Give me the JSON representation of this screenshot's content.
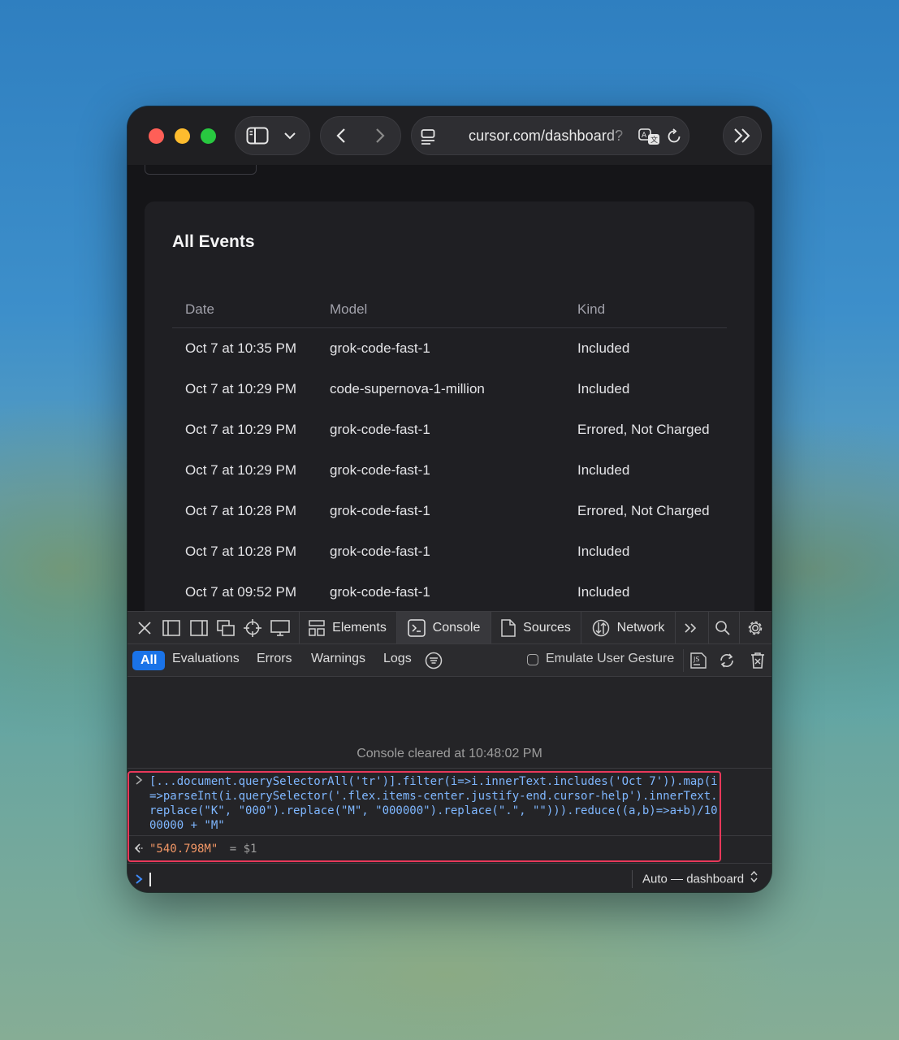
{
  "browser": {
    "url": "cursor.com/dashboard?",
    "colors": {
      "close": "#ff5f57",
      "minimize": "#febc2e",
      "zoom": "#28c840"
    }
  },
  "page": {
    "card_title": "All Events",
    "columns": [
      "Date",
      "Model",
      "Kind"
    ],
    "rows": [
      {
        "date": "Oct 7 at 10:35 PM",
        "model": "grok-code-fast-1",
        "kind": "Included"
      },
      {
        "date": "Oct 7 at 10:29 PM",
        "model": "code-supernova-1-million",
        "kind": "Included"
      },
      {
        "date": "Oct 7 at 10:29 PM",
        "model": "grok-code-fast-1",
        "kind": "Errored, Not Charged"
      },
      {
        "date": "Oct 7 at 10:29 PM",
        "model": "grok-code-fast-1",
        "kind": "Included"
      },
      {
        "date": "Oct 7 at 10:28 PM",
        "model": "grok-code-fast-1",
        "kind": "Errored, Not Charged"
      },
      {
        "date": "Oct 7 at 10:28 PM",
        "model": "grok-code-fast-1",
        "kind": "Included"
      },
      {
        "date": "Oct 7 at 09:52 PM",
        "model": "grok-code-fast-1",
        "kind": "Included"
      }
    ]
  },
  "devtools": {
    "tabs": {
      "elements": "Elements",
      "console": "Console",
      "sources": "Sources",
      "network": "Network"
    },
    "filters": {
      "all": "All",
      "evaluations": "Evaluations",
      "errors": "Errors",
      "warnings": "Warnings",
      "logs": "Logs",
      "emulate": "Emulate User Gesture"
    },
    "console": {
      "cleared": "Console cleared at 10:48:02 PM",
      "input": "[...document.querySelectorAll('tr')].filter(i=>i.innerText.includes('Oct 7')).map(i=>parseInt(i.querySelector('.flex.items-center.justify-end.cursor-help').innerText.replace(\"K\", \"000\").replace(\"M\", \"000000\").replace(\".\", \"\"))).reduce((a,b)=>a+b)/1000000 + \"M\"",
      "result_value": "\"540.798M\"",
      "result_ref": "= $1",
      "context": "Auto — dashboard"
    }
  }
}
